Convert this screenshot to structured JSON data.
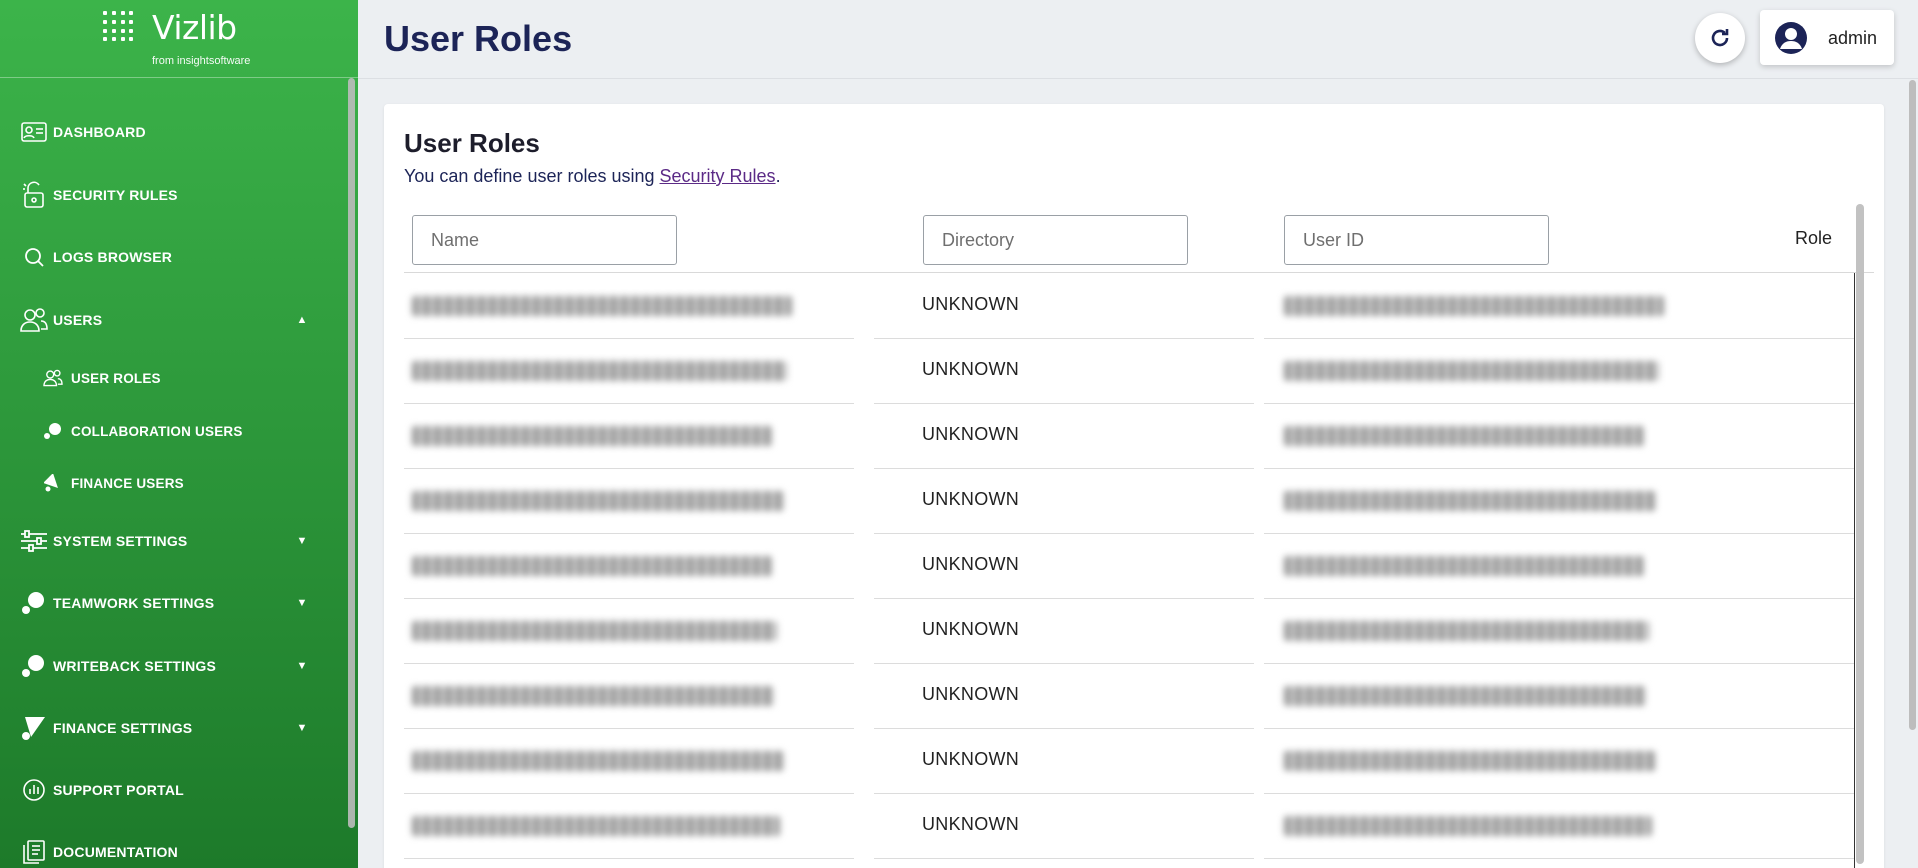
{
  "brand": {
    "name": "Vizlib",
    "tagline": "from insightsoftware"
  },
  "sidebar": {
    "items": [
      {
        "label": "DASHBOARD",
        "icon": "dashboard-icon"
      },
      {
        "label": "SECURITY RULES",
        "icon": "lock-icon"
      },
      {
        "label": "LOGS BROWSER",
        "icon": "search-icon"
      },
      {
        "label": "USERS",
        "icon": "users-icon",
        "expanded": true
      },
      {
        "label": "USER ROLES",
        "icon": "user-roles-icon",
        "sub": true,
        "active": true
      },
      {
        "label": "COLLABORATION USERS",
        "icon": "collaboration-icon",
        "sub": true
      },
      {
        "label": "FINANCE USERS",
        "icon": "finance-icon",
        "sub": true
      },
      {
        "label": "SYSTEM SETTINGS",
        "icon": "sliders-icon",
        "expandable": true
      },
      {
        "label": "TEAMWORK SETTINGS",
        "icon": "teamwork-icon",
        "expandable": true
      },
      {
        "label": "WRITEBACK SETTINGS",
        "icon": "writeback-icon",
        "expandable": true
      },
      {
        "label": "FINANCE SETTINGS",
        "icon": "finance-settings-icon",
        "expandable": true
      },
      {
        "label": "SUPPORT PORTAL",
        "icon": "support-icon"
      },
      {
        "label": "DOCUMENTATION",
        "icon": "documentation-icon"
      }
    ]
  },
  "header": {
    "title": "User Roles",
    "user": "admin"
  },
  "card": {
    "title": "User Roles",
    "desc_prefix": "You can define user roles using ",
    "desc_link": "Security Rules",
    "desc_suffix": "."
  },
  "table": {
    "filters": {
      "name_placeholder": "Name",
      "directory_placeholder": "Directory",
      "userid_placeholder": "User ID"
    },
    "role_header": "Role",
    "rows": [
      {
        "directory": "UNKNOWN"
      },
      {
        "directory": "UNKNOWN"
      },
      {
        "directory": "UNKNOWN"
      },
      {
        "directory": "UNKNOWN"
      },
      {
        "directory": "UNKNOWN"
      },
      {
        "directory": "UNKNOWN"
      },
      {
        "directory": "UNKNOWN"
      },
      {
        "directory": "UNKNOWN"
      },
      {
        "directory": "UNKNOWN"
      }
    ]
  },
  "colors": {
    "accent": "#3cb44a",
    "title": "#1c2457",
    "link": "#5b2a86"
  }
}
